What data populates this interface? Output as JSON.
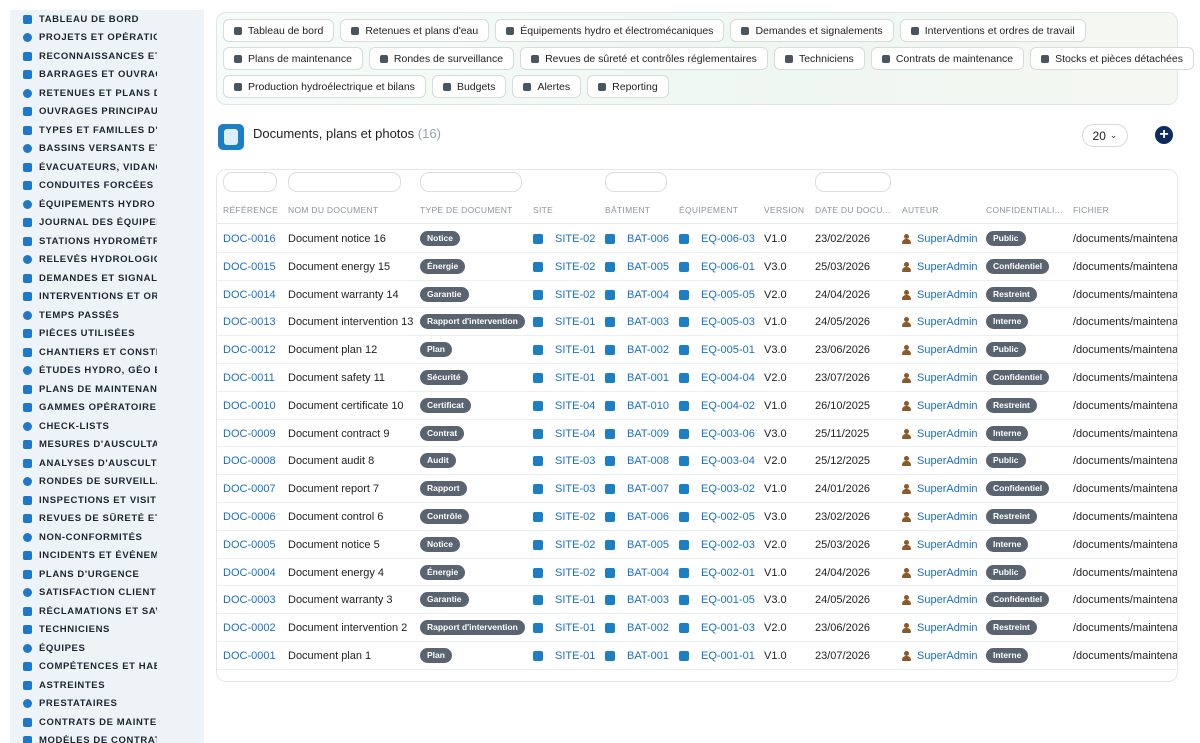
{
  "sidebar": {
    "items": [
      {
        "label": "TABLEAU DE BORD",
        "icon": "dashboard-icon"
      },
      {
        "label": "PROJETS ET OPÉRATIONS",
        "icon": "target-icon"
      },
      {
        "label": "RECONNAISSANCES ET VISITES",
        "icon": "map-marker-icon"
      },
      {
        "label": "BARRAGES ET OUVRAGES",
        "icon": "water-drop-icon"
      },
      {
        "label": "RETENUES ET PLANS D'EAU",
        "icon": "reservoir-icon"
      },
      {
        "label": "OUVRAGES PRINCIPAUX",
        "icon": "structure-icon"
      },
      {
        "label": "TYPES ET FAMILLES D'OUVRAGES",
        "icon": "hierarchy-icon"
      },
      {
        "label": "BASSINS VERSANTS ET AFFLUENTS",
        "icon": "grid-icon"
      },
      {
        "label": "ÉVACUATEURS, VIDANGES",
        "icon": "faucet-icon"
      },
      {
        "label": "CONDUITES FORCÉES ET GALERIES",
        "icon": "pipe-icon"
      },
      {
        "label": "ÉQUIPEMENTS HYDRO ET ÉLECTRO",
        "icon": "gears-icon"
      },
      {
        "label": "JOURNAL DES ÉQUIPEMENTS",
        "icon": "history-icon"
      },
      {
        "label": "STATIONS HYDROMÉTRIQUES",
        "icon": "tower-icon"
      },
      {
        "label": "RELEVÉS HYDROLOGIQUES",
        "icon": "chart-icon"
      },
      {
        "label": "DEMANDES ET SIGNALEMENTS",
        "icon": "question-icon"
      },
      {
        "label": "INTERVENTIONS ET ORDRES DE TRAVAIL",
        "icon": "clipboard-icon"
      },
      {
        "label": "TEMPS PASSÉS",
        "icon": "clock-icon"
      },
      {
        "label": "PIÈCES UTILISÉES",
        "icon": "box-icon"
      },
      {
        "label": "CHANTIERS ET CONSTRUCTIONS",
        "icon": "hammer-icon"
      },
      {
        "label": "ÉTUDES HYDRO, GÉO ET ENVIRONNEMENT",
        "icon": "flask-icon"
      },
      {
        "label": "PLANS DE MAINTENANCE",
        "icon": "calendar-icon"
      },
      {
        "label": "GAMMES OPÉRATOIRES",
        "icon": "list-icon"
      },
      {
        "label": "CHECK-LISTS",
        "icon": "checklist-icon"
      },
      {
        "label": "MESURES D'AUSCULTATION",
        "icon": "thermometer-icon"
      },
      {
        "label": "ANALYSES D'AUSCULTATION",
        "icon": "line-chart-icon"
      },
      {
        "label": "RONDES DE SURVEILLANCE",
        "icon": "route-icon"
      },
      {
        "label": "INSPECTIONS ET VISITES",
        "icon": "magnifier-icon"
      },
      {
        "label": "REVUES DE SÛRETÉ ET CONTRÔLES",
        "icon": "document-check-icon"
      },
      {
        "label": "NON-CONFORMITÉS",
        "icon": "alert-circle-icon"
      },
      {
        "label": "INCIDENTS ET ÉVÉNEMENTS",
        "icon": "warning-icon"
      },
      {
        "label": "PLANS D'URGENCE",
        "icon": "flag-icon"
      },
      {
        "label": "SATISFACTION CLIENT",
        "icon": "smile-icon"
      },
      {
        "label": "RÉCLAMATIONS ET SAV",
        "icon": "speech-icon"
      },
      {
        "label": "TECHNICIENS",
        "icon": "helmet-icon"
      },
      {
        "label": "ÉQUIPES",
        "icon": "team-icon"
      },
      {
        "label": "COMPÉTENCES ET HABILITATIONS",
        "icon": "badge-icon"
      },
      {
        "label": "ASTREINTES",
        "icon": "user-clock-icon"
      },
      {
        "label": "PRESTATAIRES",
        "icon": "handshake-icon"
      },
      {
        "label": "CONTRATS DE MAINTENANCE",
        "icon": "contract-icon"
      },
      {
        "label": "MODÈLES DE CONTRATS",
        "icon": "template-icon"
      }
    ]
  },
  "topnav": {
    "rows": [
      [
        {
          "label": "Tableau de bord",
          "icon": "dashboard-icon"
        },
        {
          "label": "Retenues et plans d'eau",
          "icon": "building-icon"
        },
        {
          "label": "Équipements hydro et électromécaniques",
          "icon": "gears-icon"
        },
        {
          "label": "Demandes et signalements",
          "icon": "question-icon"
        },
        {
          "label": "Interventions et ordres de travail",
          "icon": "clipboard-icon"
        }
      ],
      [
        {
          "label": "Plans de maintenance",
          "icon": "calendar-icon"
        },
        {
          "label": "Rondes de surveillance",
          "icon": "route-icon"
        },
        {
          "label": "Revues de sûreté et contrôles réglementaires",
          "icon": "document-check-icon"
        },
        {
          "label": "Techniciens",
          "icon": "helmet-icon"
        },
        {
          "label": "Contrats de maintenance",
          "icon": "contract-icon"
        },
        {
          "label": "Stocks et pièces détachées",
          "icon": "boxes-icon"
        }
      ],
      [
        {
          "label": "Production hydroélectrique et bilans",
          "icon": "bolt-icon"
        },
        {
          "label": "Budgets",
          "icon": "money-icon"
        },
        {
          "label": "Alertes",
          "icon": "bell-icon"
        },
        {
          "label": "Reporting",
          "icon": "pie-icon"
        }
      ]
    ]
  },
  "header": {
    "title": "Documents, plans et photos",
    "count": "(16)",
    "page_size": "20",
    "add_icon": "plus-circle-icon"
  },
  "table": {
    "columns": [
      "RÉFÉRENCE",
      "NOM DU DOCUMENT",
      "TYPE DE DOCUMENT",
      "SITE",
      "BÂTIMENT",
      "ÉQUIPEMENT",
      "VERSION",
      "DATE DU DOCU...",
      "AUTEUR",
      "CONFIDENTIALI...",
      "FICHIER"
    ],
    "rows": [
      {
        "ref": "DOC-0016",
        "name": "Document notice 16",
        "type": "Notice",
        "site": "SITE-02",
        "building": "BAT-006",
        "equipment": "EQ-006-03",
        "version": "V1.0",
        "date": "23/02/2026",
        "author": "SuperAdmin",
        "confidentiality": "Public",
        "file": "/documents/maintenance"
      },
      {
        "ref": "DOC-0015",
        "name": "Document energy 15",
        "type": "Énergie",
        "site": "SITE-02",
        "building": "BAT-005",
        "equipment": "EQ-006-01",
        "version": "V3.0",
        "date": "25/03/2026",
        "author": "SuperAdmin",
        "confidentiality": "Confidentiel",
        "file": "/documents/maintenance"
      },
      {
        "ref": "DOC-0014",
        "name": "Document warranty 14",
        "type": "Garantie",
        "site": "SITE-02",
        "building": "BAT-004",
        "equipment": "EQ-005-05",
        "version": "V2.0",
        "date": "24/04/2026",
        "author": "SuperAdmin",
        "confidentiality": "Restreint",
        "file": "/documents/maintenance"
      },
      {
        "ref": "DOC-0013",
        "name": "Document intervention 13",
        "type": "Rapport d'intervention",
        "site": "SITE-01",
        "building": "BAT-003",
        "equipment": "EQ-005-03",
        "version": "V1.0",
        "date": "24/05/2026",
        "author": "SuperAdmin",
        "confidentiality": "Interne",
        "file": "/documents/maintenance"
      },
      {
        "ref": "DOC-0012",
        "name": "Document plan 12",
        "type": "Plan",
        "site": "SITE-01",
        "building": "BAT-002",
        "equipment": "EQ-005-01",
        "version": "V3.0",
        "date": "23/06/2026",
        "author": "SuperAdmin",
        "confidentiality": "Public",
        "file": "/documents/maintenance"
      },
      {
        "ref": "DOC-0011",
        "name": "Document safety 11",
        "type": "Sécurité",
        "site": "SITE-01",
        "building": "BAT-001",
        "equipment": "EQ-004-04",
        "version": "V2.0",
        "date": "23/07/2026",
        "author": "SuperAdmin",
        "confidentiality": "Confidentiel",
        "file": "/documents/maintenance"
      },
      {
        "ref": "DOC-0010",
        "name": "Document certificate 10",
        "type": "Certificat",
        "site": "SITE-04",
        "building": "BAT-010",
        "equipment": "EQ-004-02",
        "version": "V1.0",
        "date": "26/10/2025",
        "author": "SuperAdmin",
        "confidentiality": "Restreint",
        "file": "/documents/maintenance"
      },
      {
        "ref": "DOC-0009",
        "name": "Document contract 9",
        "type": "Contrat",
        "site": "SITE-04",
        "building": "BAT-009",
        "equipment": "EQ-003-06",
        "version": "V3.0",
        "date": "25/11/2025",
        "author": "SuperAdmin",
        "confidentiality": "Interne",
        "file": "/documents/maintenance"
      },
      {
        "ref": "DOC-0008",
        "name": "Document audit 8",
        "type": "Audit",
        "site": "SITE-03",
        "building": "BAT-008",
        "equipment": "EQ-003-04",
        "version": "V2.0",
        "date": "25/12/2025",
        "author": "SuperAdmin",
        "confidentiality": "Public",
        "file": "/documents/maintenance"
      },
      {
        "ref": "DOC-0007",
        "name": "Document report 7",
        "type": "Rapport",
        "site": "SITE-03",
        "building": "BAT-007",
        "equipment": "EQ-003-02",
        "version": "V1.0",
        "date": "24/01/2026",
        "author": "SuperAdmin",
        "confidentiality": "Confidentiel",
        "file": "/documents/maintenance"
      },
      {
        "ref": "DOC-0006",
        "name": "Document control 6",
        "type": "Contrôle",
        "site": "SITE-02",
        "building": "BAT-006",
        "equipment": "EQ-002-05",
        "version": "V3.0",
        "date": "23/02/2026",
        "author": "SuperAdmin",
        "confidentiality": "Restreint",
        "file": "/documents/maintenance"
      },
      {
        "ref": "DOC-0005",
        "name": "Document notice 5",
        "type": "Notice",
        "site": "SITE-02",
        "building": "BAT-005",
        "equipment": "EQ-002-03",
        "version": "V2.0",
        "date": "25/03/2026",
        "author": "SuperAdmin",
        "confidentiality": "Interne",
        "file": "/documents/maintenance"
      },
      {
        "ref": "DOC-0004",
        "name": "Document energy 4",
        "type": "Énergie",
        "site": "SITE-02",
        "building": "BAT-004",
        "equipment": "EQ-002-01",
        "version": "V1.0",
        "date": "24/04/2026",
        "author": "SuperAdmin",
        "confidentiality": "Public",
        "file": "/documents/maintenance"
      },
      {
        "ref": "DOC-0003",
        "name": "Document warranty 3",
        "type": "Garantie",
        "site": "SITE-01",
        "building": "BAT-003",
        "equipment": "EQ-001-05",
        "version": "V3.0",
        "date": "24/05/2026",
        "author": "SuperAdmin",
        "confidentiality": "Confidentiel",
        "file": "/documents/maintenance"
      },
      {
        "ref": "DOC-0002",
        "name": "Document intervention 2",
        "type": "Rapport d'intervention",
        "site": "SITE-01",
        "building": "BAT-002",
        "equipment": "EQ-001-03",
        "version": "V2.0",
        "date": "23/06/2026",
        "author": "SuperAdmin",
        "confidentiality": "Restreint",
        "file": "/documents/maintenance"
      },
      {
        "ref": "DOC-0001",
        "name": "Document plan 1",
        "type": "Plan",
        "site": "SITE-01",
        "building": "BAT-001",
        "equipment": "EQ-001-01",
        "version": "V1.0",
        "date": "23/07/2026",
        "author": "SuperAdmin",
        "confidentiality": "Interne",
        "file": "/documents/maintenance"
      }
    ]
  },
  "colors": {
    "accent": "#1a6fc4",
    "badge": "#5a6470",
    "add_button": "#0f2a5c",
    "sidebar_bg": "#eef3f8"
  }
}
